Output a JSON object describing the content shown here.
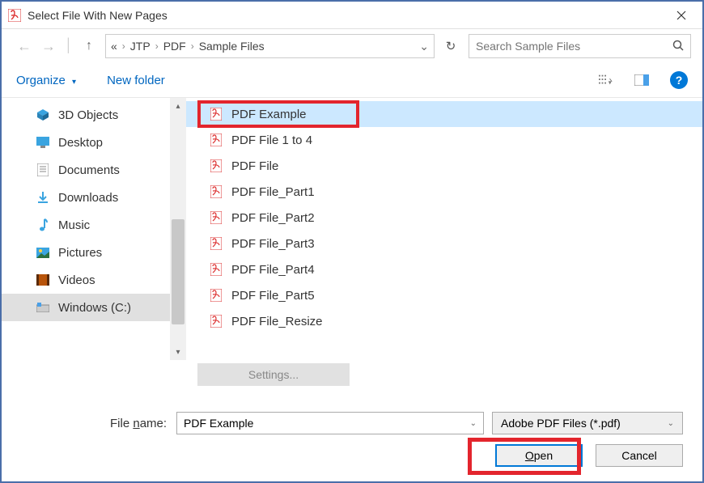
{
  "title": "Select File With New Pages",
  "breadcrumb": {
    "b0": "JTP",
    "b1": "PDF",
    "b2": "Sample Files",
    "prefix": "«"
  },
  "search": {
    "placeholder": "Search Sample Files"
  },
  "toolbar": {
    "organize": "Organize",
    "newfolder": "New folder"
  },
  "sidebar": {
    "items": [
      {
        "label": "3D Objects"
      },
      {
        "label": "Desktop"
      },
      {
        "label": "Documents"
      },
      {
        "label": "Downloads"
      },
      {
        "label": "Music"
      },
      {
        "label": "Pictures"
      },
      {
        "label": "Videos"
      },
      {
        "label": "Windows (C:)"
      }
    ]
  },
  "files": {
    "items": [
      {
        "label": "PDF Example"
      },
      {
        "label": "PDF File 1 to 4"
      },
      {
        "label": "PDF File"
      },
      {
        "label": "PDF File_Part1"
      },
      {
        "label": "PDF File_Part2"
      },
      {
        "label": "PDF File_Part3"
      },
      {
        "label": "PDF File_Part4"
      },
      {
        "label": "PDF File_Part5"
      },
      {
        "label": "PDF File_Resize"
      }
    ]
  },
  "settings_label": "Settings...",
  "filename": {
    "label_pre": "File ",
    "label_u": "n",
    "label_post": "ame:",
    "value": "PDF Example"
  },
  "filter": {
    "label": "Adobe PDF Files (*.pdf)"
  },
  "buttons": {
    "open_u": "O",
    "open_post": "pen",
    "cancel": "Cancel"
  }
}
